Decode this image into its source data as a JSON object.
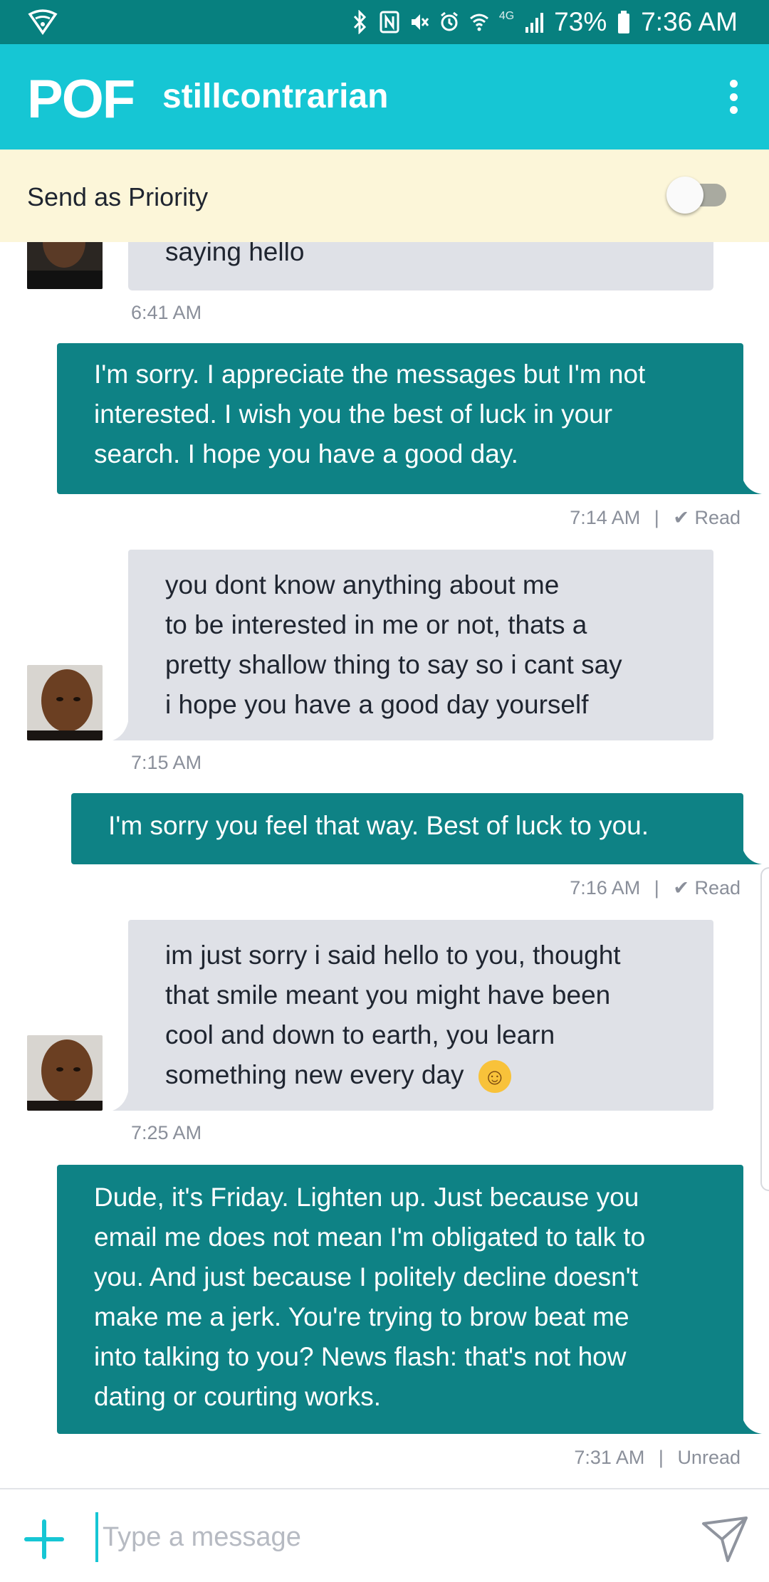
{
  "status_bar": {
    "battery": "73%",
    "time": "7:36 AM",
    "network": "4G",
    "icons": [
      "shield-wifi-icon",
      "bluetooth-icon",
      "nfc-icon",
      "mute-icon",
      "alarm-icon",
      "wifi-icon",
      "signal-icon",
      "battery-icon"
    ]
  },
  "app_bar": {
    "logo": "POF",
    "username": "stillcontrarian",
    "menu_icon": "more-vertical-icon"
  },
  "priority": {
    "label": "Send as Priority",
    "enabled": false
  },
  "messages": [
    {
      "direction": "in",
      "text": "saying hello",
      "timestamp": "6:41 AM"
    },
    {
      "direction": "out",
      "text": "I'm sorry.  I appreciate the messages but I'm not\ninterested.  I wish you the best of luck in your\nsearch.  I hope you have a good day.",
      "timestamp": "7:14 AM",
      "status": "Read"
    },
    {
      "direction": "in",
      "text": "you dont know anything about me\nto be interested in me or not, thats a\npretty shallow thing to say so i cant say\ni hope you have a good day yourself",
      "timestamp": "7:15 AM"
    },
    {
      "direction": "out",
      "text": "I'm sorry you feel that way.  Best of luck to you.",
      "timestamp": "7:16 AM",
      "status": "Read"
    },
    {
      "direction": "in",
      "text": "im just sorry i said hello to you, thought\nthat smile meant you might have been\ncool and down to earth, you learn\nsomething new every day",
      "emoji": "☺",
      "timestamp": "7:25 AM"
    },
    {
      "direction": "out",
      "text": "Dude, it's Friday.  Lighten up.  Just because you\nemail me does not mean I'm obligated to talk to\nyou.  And just because I politely decline doesn't\nmake me a jerk.  You're trying to brow beat me\ninto talking to you?  News flash: that's not how\ndating or courting works.",
      "timestamp": "7:31 AM",
      "status": "Unread"
    }
  ],
  "separator": "|",
  "read_check": "✔",
  "composer": {
    "placeholder": "Type a message",
    "add_icon": "plus-icon",
    "send_icon": "send-icon"
  },
  "colors": {
    "status_bar": "#07807f",
    "app_bar": "#16c6d4",
    "priority_bg": "#fcf6d9",
    "incoming_bubble": "#dfe1e7",
    "outgoing_bubble": "#0e8285"
  }
}
